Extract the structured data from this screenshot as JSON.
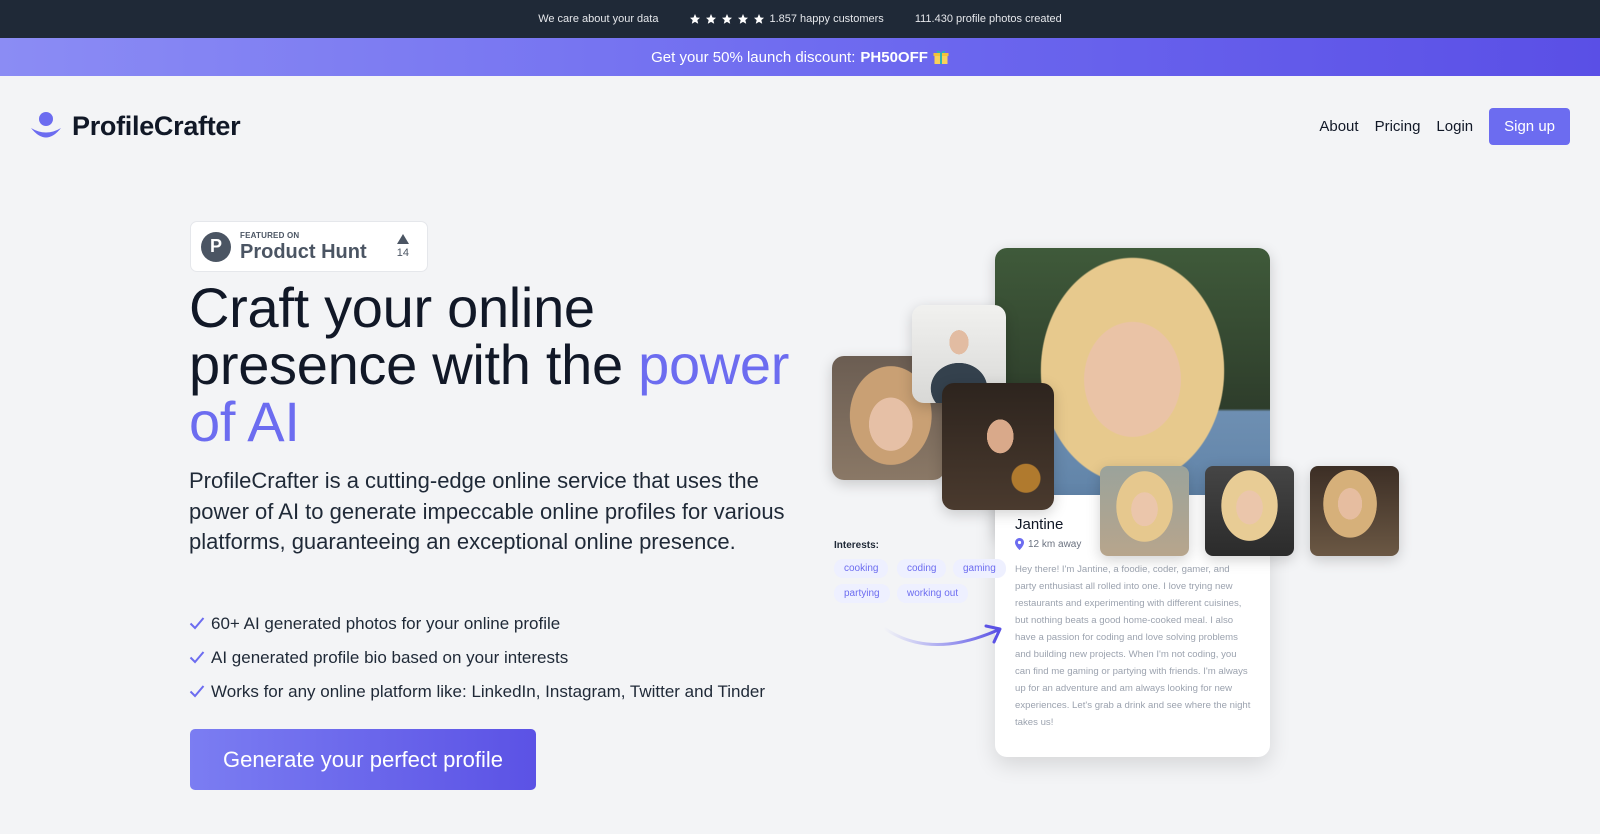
{
  "topbar": {
    "data_text": "We care about your data",
    "customers": "1.857 happy customers",
    "photos": "111.430 profile photos created",
    "rating_stars": 5
  },
  "promo": {
    "text": "Get your 50% launch discount:",
    "code": "PH50OFF"
  },
  "nav": {
    "logo": "ProfileCrafter",
    "links": [
      "About",
      "Pricing",
      "Login"
    ],
    "signup": "Sign up"
  },
  "product_hunt": {
    "featured": "FEATURED ON",
    "name": "Product Hunt",
    "votes": "14",
    "logo_letter": "P"
  },
  "hero": {
    "headline_line1": "Craft your online",
    "headline_line2": "presence with the ",
    "headline_accent1": "power",
    "headline_accent2": "of AI",
    "description": "ProfileCrafter is a cutting-edge online service that uses the power of AI to generate impeccable online profiles for various platforms, guaranteeing an exceptional online presence.",
    "features": [
      "60+ AI generated photos for your online profile",
      "AI generated profile bio based on your interests",
      "Works for any online platform like: LinkedIn, Instagram, Twitter and Tinder"
    ],
    "cta": "Generate your perfect profile"
  },
  "profile": {
    "name": "Jantine",
    "distance": "12 km away",
    "bio": "Hey there! I'm Jantine, a foodie, coder, gamer, and party enthusiast all rolled into one. I love trying new restaurants and experimenting with different cuisines, but nothing beats a good home-cooked meal. I also have a passion for coding and love solving problems and building new projects. When I'm not coding, you can find me gaming or partying with friends. I'm always up for an adventure and am always looking for new experiences. Let's grab a drink and see where the night takes us!",
    "interests_label": "Interests:",
    "interests": [
      "cooking",
      "coding",
      "gaming",
      "partying",
      "working out"
    ]
  },
  "colors": {
    "accent": "#6c6cf0",
    "topbar_bg": "#1f2937",
    "page_bg": "#f3f4f6"
  }
}
